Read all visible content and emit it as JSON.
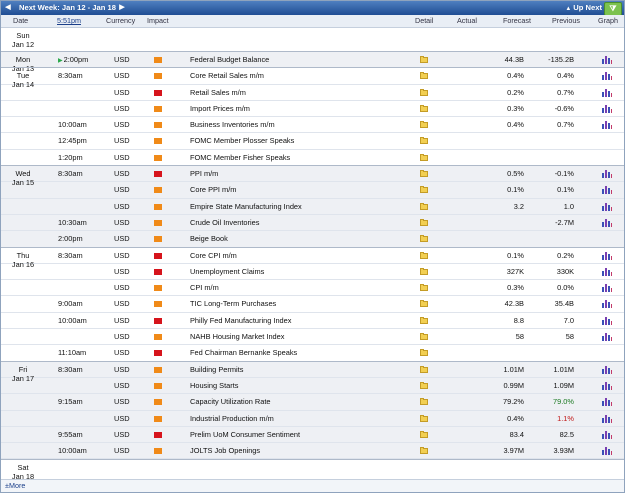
{
  "nav": {
    "title": "Next Week: Jan 12 - Jan 18",
    "up_next": "Up Next"
  },
  "columns": {
    "date": "Date",
    "time": "5:51pm",
    "currency": "Currency",
    "impact": "Impact",
    "detail": "Detail",
    "actual": "Actual",
    "forecast": "Forecast",
    "previous": "Previous",
    "graph": "Graph"
  },
  "days": [
    {
      "dow": "Sun",
      "date": "Jan 12"
    },
    {
      "dow": "Mon",
      "date": "Jan 13"
    },
    {
      "dow": "Tue",
      "date": "Jan 14"
    },
    {
      "dow": "Wed",
      "date": "Jan 15"
    },
    {
      "dow": "Thu",
      "date": "Jan 16"
    },
    {
      "dow": "Fri",
      "date": "Jan 17"
    },
    {
      "dow": "Sat",
      "date": "Jan 18"
    }
  ],
  "events": [
    {
      "time": "2:00pm",
      "currency": "USD",
      "impact": "med",
      "name": "Federal Budget Balance",
      "forecast": "44.3B",
      "previous": "-135.2B",
      "prev_style": "",
      "graph": true
    },
    {
      "time": "8:30am",
      "currency": "USD",
      "impact": "med",
      "name": "Core Retail Sales m/m",
      "forecast": "0.4%",
      "previous": "0.4%",
      "prev_style": "",
      "graph": true
    },
    {
      "time": "",
      "currency": "USD",
      "impact": "high",
      "name": "Retail Sales m/m",
      "forecast": "0.2%",
      "previous": "0.7%",
      "prev_style": "",
      "graph": true
    },
    {
      "time": "",
      "currency": "USD",
      "impact": "med",
      "name": "Import Prices m/m",
      "forecast": "0.3%",
      "previous": "-0.6%",
      "prev_style": "",
      "graph": true
    },
    {
      "time": "10:00am",
      "currency": "USD",
      "impact": "med",
      "name": "Business Inventories m/m",
      "forecast": "0.4%",
      "previous": "0.7%",
      "prev_style": "",
      "graph": true
    },
    {
      "time": "12:45pm",
      "currency": "USD",
      "impact": "med",
      "name": "FOMC Member Plosser Speaks",
      "forecast": "",
      "previous": "",
      "prev_style": "",
      "graph": false
    },
    {
      "time": "1:20pm",
      "currency": "USD",
      "impact": "med",
      "name": "FOMC Member Fisher Speaks",
      "forecast": "",
      "previous": "",
      "prev_style": "",
      "graph": false
    },
    {
      "time": "8:30am",
      "currency": "USD",
      "impact": "high",
      "name": "PPI m/m",
      "forecast": "0.5%",
      "previous": "-0.1%",
      "prev_style": "",
      "graph": true
    },
    {
      "time": "",
      "currency": "USD",
      "impact": "med",
      "name": "Core PPI m/m",
      "forecast": "0.1%",
      "previous": "0.1%",
      "prev_style": "",
      "graph": true
    },
    {
      "time": "",
      "currency": "USD",
      "impact": "med",
      "name": "Empire State Manufacturing Index",
      "forecast": "3.2",
      "previous": "1.0",
      "prev_style": "",
      "graph": true
    },
    {
      "time": "10:30am",
      "currency": "USD",
      "impact": "med",
      "name": "Crude Oil Inventories",
      "forecast": "",
      "previous": "-2.7M",
      "prev_style": "",
      "graph": true
    },
    {
      "time": "2:00pm",
      "currency": "USD",
      "impact": "med",
      "name": "Beige Book",
      "forecast": "",
      "previous": "",
      "prev_style": "",
      "graph": false
    },
    {
      "time": "8:30am",
      "currency": "USD",
      "impact": "high",
      "name": "Core CPI m/m",
      "forecast": "0.1%",
      "previous": "0.2%",
      "prev_style": "",
      "graph": true
    },
    {
      "time": "",
      "currency": "USD",
      "impact": "high",
      "name": "Unemployment Claims",
      "forecast": "327K",
      "previous": "330K",
      "prev_style": "",
      "graph": true
    },
    {
      "time": "",
      "currency": "USD",
      "impact": "med",
      "name": "CPI m/m",
      "forecast": "0.3%",
      "previous": "0.0%",
      "prev_style": "",
      "graph": true
    },
    {
      "time": "9:00am",
      "currency": "USD",
      "impact": "med",
      "name": "TIC Long-Term Purchases",
      "forecast": "42.3B",
      "previous": "35.4B",
      "prev_style": "",
      "graph": true
    },
    {
      "time": "10:00am",
      "currency": "USD",
      "impact": "high",
      "name": "Philly Fed Manufacturing Index",
      "forecast": "8.8",
      "previous": "7.0",
      "prev_style": "",
      "graph": true
    },
    {
      "time": "",
      "currency": "USD",
      "impact": "med",
      "name": "NAHB Housing Market Index",
      "forecast": "58",
      "previous": "58",
      "prev_style": "",
      "graph": true
    },
    {
      "time": "11:10am",
      "currency": "USD",
      "impact": "high",
      "name": "Fed Chairman Bernanke Speaks",
      "forecast": "",
      "previous": "",
      "prev_style": "",
      "graph": false
    },
    {
      "time": "8:30am",
      "currency": "USD",
      "impact": "med",
      "name": "Building Permits",
      "forecast": "1.01M",
      "previous": "1.01M",
      "prev_style": "",
      "graph": true
    },
    {
      "time": "",
      "currency": "USD",
      "impact": "med",
      "name": "Housing Starts",
      "forecast": "0.99M",
      "previous": "1.09M",
      "prev_style": "",
      "graph": true
    },
    {
      "time": "9:15am",
      "currency": "USD",
      "impact": "med",
      "name": "Capacity Utilization Rate",
      "forecast": "79.2%",
      "previous": "79.0%",
      "prev_style": "better",
      "graph": true
    },
    {
      "time": "",
      "currency": "USD",
      "impact": "med",
      "name": "Industrial Production m/m",
      "forecast": "0.4%",
      "previous": "1.1%",
      "prev_style": "worse",
      "graph": true
    },
    {
      "time": "9:55am",
      "currency": "USD",
      "impact": "high",
      "name": "Prelim UoM Consumer Sentiment",
      "forecast": "83.4",
      "previous": "82.5",
      "prev_style": "",
      "graph": true
    },
    {
      "time": "10:00am",
      "currency": "USD",
      "impact": "med",
      "name": "JOLTS Job Openings",
      "forecast": "3.97M",
      "previous": "3.93M",
      "prev_style": "",
      "graph": true
    }
  ],
  "more_label": "More"
}
